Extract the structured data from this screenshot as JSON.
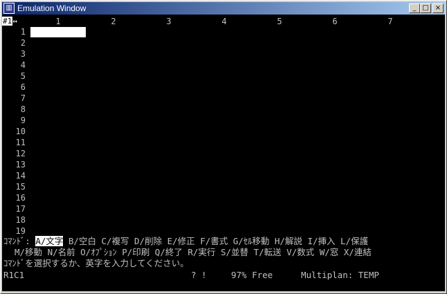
{
  "window": {
    "title": "Emulation Window",
    "icon": "app-icon",
    "buttons": {
      "minimize": "_",
      "maximize": "□",
      "close": "×"
    }
  },
  "grid": {
    "window_number": "#1",
    "arrow": "↔",
    "columns": [
      "1",
      "2",
      "3",
      "4",
      "5",
      "6",
      "7"
    ],
    "rows": [
      "1",
      "2",
      "3",
      "4",
      "5",
      "6",
      "7",
      "8",
      "9",
      "10",
      "11",
      "12",
      "13",
      "14",
      "15",
      "16",
      "17",
      "18",
      "19"
    ],
    "active_cell": {
      "row": 1,
      "column": 1
    }
  },
  "command": {
    "label": "ｺﾏﾝﾄﾞ: ",
    "selected": "A/文字",
    "line1_rest": " B/空白 C/複写 D/削除 E/修正 F/書式 G/ｾﾙ移動 H/解説 I/挿入 L/保護",
    "line2": "M/移動 N/名前 O/ｵﾌﾟｼｮﾝ P/印刷 Q/終了 R/実行 S/並替 T/転送 V/数式 W/窓 X/連結",
    "prompt": "ｺﾏﾝﾄﾞを選択するか、英字を入力してください。"
  },
  "status": {
    "cell": "R1C1",
    "flags": "? !",
    "free": "97% Free",
    "app": "Multiplan: TEMP"
  },
  "colors": {
    "title_start": "#0a246a",
    "title_end": "#a6caf0",
    "screen_bg": "#000000",
    "screen_text": "#c0c0c0",
    "cursor": "#ffffff"
  }
}
